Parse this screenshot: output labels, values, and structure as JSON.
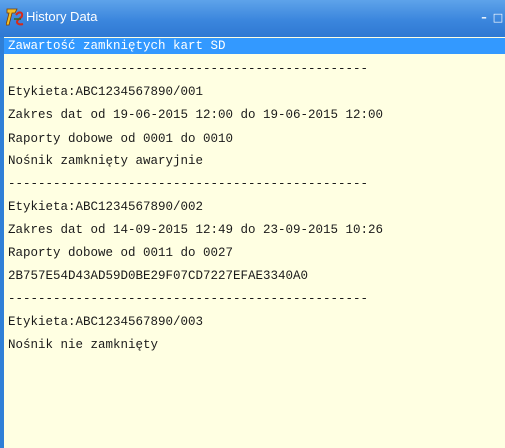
{
  "window": {
    "title": "History Data",
    "controls": {
      "minimize": "–",
      "maximize": "□",
      "close": "×"
    },
    "accent": "#2f7fd7"
  },
  "content": {
    "background": "#ffffe2",
    "selected_index": 0,
    "lines": [
      "Zawartość zamkniętych kart SD",
      "------------------------------------------------",
      "Etykieta:ABC1234567890/001",
      "Zakres dat od 19-06-2015 12:00 do 19-06-2015 12:00",
      "Raporty dobowe od 0001 do 0010",
      "Nośnik zamknięty awaryjnie",
      "------------------------------------------------",
      "Etykieta:ABC1234567890/002",
      "Zakres dat od 14-09-2015 12:49 do 23-09-2015 10:26",
      "Raporty dobowe od 0011 do 0027",
      "2B757E54D43AD59D0BE29F07CD7227EFAE3340A0",
      "------------------------------------------------",
      "Etykieta:ABC1234567890/003",
      "Nośnik nie zamknięty"
    ]
  }
}
